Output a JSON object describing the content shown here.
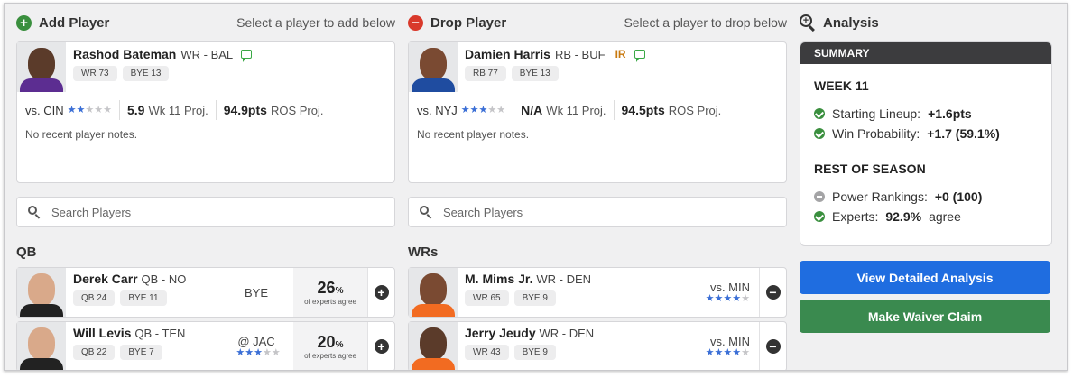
{
  "add": {
    "title": "Add Player",
    "hint": "Select a player to add below",
    "player": {
      "name": "Rashod Bateman",
      "pos_team": "WR - BAL",
      "chips": [
        "WR 73",
        "BYE 13"
      ],
      "opp": "vs. CIN",
      "stars": 2,
      "wk_proj_value": "5.9",
      "wk_proj_label": "Wk 11 Proj.",
      "ros_value": "94.9pts",
      "ros_label": "ROS Proj.",
      "notes": "No recent player notes."
    },
    "search_placeholder": "Search Players",
    "section": "QB",
    "rows": [
      {
        "name": "Derek Carr",
        "pos_team": "QB - NO",
        "chips": [
          "QB 24",
          "BYE 11"
        ],
        "matchup": "BYE",
        "stars": 0,
        "pct": "26",
        "pct_unit": "%",
        "pct_sub": "of experts agree"
      },
      {
        "name": "Will Levis",
        "pos_team": "QB - TEN",
        "chips": [
          "QB 22",
          "BYE 7"
        ],
        "matchup": "@ JAC",
        "stars": 3,
        "pct": "20",
        "pct_unit": "%",
        "pct_sub": "of experts agree"
      }
    ]
  },
  "drop": {
    "title": "Drop Player",
    "hint": "Select a player to drop below",
    "player": {
      "name": "Damien Harris",
      "pos_team": "RB - BUF",
      "tag": "IR",
      "chips": [
        "RB 77",
        "BYE 13"
      ],
      "opp": "vs. NYJ",
      "stars": 3,
      "wk_proj_value": "N/A",
      "wk_proj_label": "Wk 11 Proj.",
      "ros_value": "94.5pts",
      "ros_label": "ROS Proj.",
      "notes": "No recent player notes."
    },
    "search_placeholder": "Search Players",
    "section": "WRs",
    "rows": [
      {
        "name": "M. Mims Jr.",
        "pos_team": "WR - DEN",
        "chips": [
          "WR 65",
          "BYE 9"
        ],
        "matchup": "vs. MIN",
        "stars": 4
      },
      {
        "name": "Jerry Jeudy",
        "pos_team": "WR - DEN",
        "chips": [
          "WR 43",
          "BYE 9"
        ],
        "matchup": "vs. MIN",
        "stars": 4
      }
    ]
  },
  "analysis": {
    "title": "Analysis",
    "summary_label": "SUMMARY",
    "week_heading": "WEEK 11",
    "lines_week": [
      {
        "label": "Starting Lineup:",
        "value": "+1.6pts",
        "status": "positive"
      },
      {
        "label": "Win Probability:",
        "value": "+1.7 (59.1%)",
        "status": "positive"
      }
    ],
    "ros_heading": "REST OF SEASON",
    "lines_ros": [
      {
        "label": "Power Rankings:",
        "value": "+0 (100)",
        "status": "neutral"
      },
      {
        "label": "Experts:",
        "value": "92.9%",
        "suffix": "agree",
        "status": "positive"
      }
    ],
    "btn_analysis": "View Detailed Analysis",
    "btn_claim": "Make Waiver Claim"
  },
  "colors": {
    "add_accent": "#3a8f3e",
    "drop_accent": "#d9392b",
    "star_on": "#3b6fd6",
    "btn_blue": "#1f6de0",
    "btn_green": "#3a8a4f",
    "ir_tag": "#c97a10"
  }
}
